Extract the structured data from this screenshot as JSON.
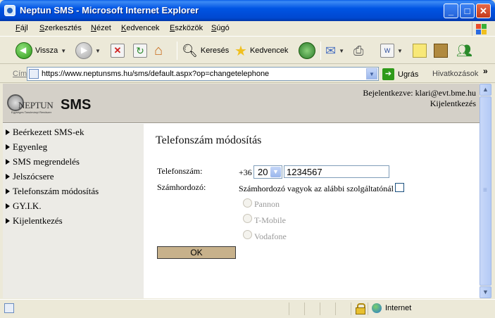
{
  "window": {
    "title": "Neptun SMS - Microsoft Internet Explorer"
  },
  "menu": {
    "items": [
      "Fájl",
      "Szerkesztés",
      "Nézet",
      "Kedvencek",
      "Eszközök",
      "Súgó"
    ]
  },
  "toolbar": {
    "back_label": "Vissza",
    "search_label": "Keresés",
    "favorites_label": "Kedvencek",
    "icons": [
      "back-arrow",
      "forward-arrow",
      "stop",
      "refresh",
      "home",
      "search",
      "favorites-star",
      "history",
      "mail",
      "print",
      "word-edit",
      "notes",
      "research",
      "messenger"
    ]
  },
  "address": {
    "label": "Cím",
    "url": "https://www.neptunsms.hu/sms/default.aspx?op=changetelephone",
    "go_label": "Ugrás",
    "links_label": "Hivatkozások"
  },
  "site": {
    "logo_text": "NEPTUN",
    "logo_sms": "SMS",
    "logo_tagline": "Egységes Tanulmányi Rendszer",
    "logged_in": "Bejelentkezve: klari@evt.bme.hu",
    "logout": "Kijelentkezés"
  },
  "sidebar": {
    "items": [
      {
        "label": "Beérkezett SMS-ek"
      },
      {
        "label": "Egyenleg"
      },
      {
        "label": "SMS megrendelés"
      },
      {
        "label": "Jelszócsere"
      },
      {
        "label": "Telefonszám módosítás"
      },
      {
        "label": "GY.I.K."
      },
      {
        "label": "Kijelentkezés"
      }
    ]
  },
  "form": {
    "title": "Telefonszám módosítás",
    "phone_label": "Telefonszám:",
    "country_code": "+36",
    "area_code_selected": "20",
    "phone_value": "1234567",
    "carrier_label": "Számhordozó:",
    "carrier_checkbox_label": "Számhordozó vagyok az alábbi szolgáltatónál",
    "carrier_checked": false,
    "carriers": [
      "Pannon",
      "T-Mobile",
      "Vodafone"
    ],
    "ok_label": "OK"
  },
  "status": {
    "zone": "Internet"
  }
}
